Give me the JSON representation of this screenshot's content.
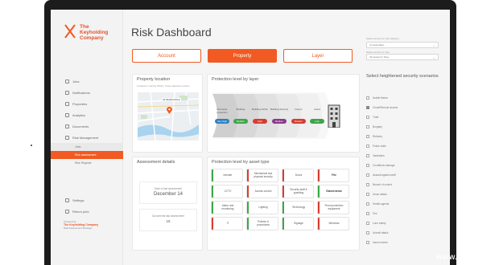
{
  "logo": {
    "line1": "The",
    "line2": "Keyholding",
    "line3": "Company"
  },
  "nav": {
    "items": [
      {
        "icon": "user-icon",
        "label": "Jobs"
      },
      {
        "icon": "clipboard-icon",
        "label": "Notifications"
      },
      {
        "icon": "building-icon",
        "label": "Properties"
      },
      {
        "icon": "chart-icon",
        "label": "Analytics"
      },
      {
        "icon": "document-icon",
        "label": "Documents"
      },
      {
        "icon": "shield-icon",
        "label": "Risk Management"
      }
    ],
    "subitems": [
      {
        "label": "Jobs",
        "state": "alt"
      },
      {
        "label": "Risk assessment",
        "state": "active"
      },
      {
        "label": "Risk Register",
        "state": ""
      }
    ],
    "bottom": [
      {
        "icon": "gear-icon",
        "label": "Settings"
      },
      {
        "icon": "logout-icon",
        "label": "Return jobs"
      }
    ],
    "powered_label": "Powered by",
    "powered_brand": "The Keyholding Company",
    "powered_sub": "Risk Assessment Manager"
  },
  "page": {
    "title": "Risk Dashboard"
  },
  "tabs": [
    {
      "label": "Account",
      "active": false
    },
    {
      "label": "Property",
      "active": true
    },
    {
      "label": "Layer",
      "active": false
    }
  ],
  "property_location": {
    "title": "Property location",
    "subtitle": "Located in Canary Wharf, Tower Hamlets London",
    "pin_label": "44 Stratford Drive"
  },
  "protection_by_layer": {
    "title": "Protection level by layer",
    "layers": [
      {
        "name": "Perimeter protection",
        "badge": "Very High",
        "color": "#2f7fc1"
      },
      {
        "name": "Building",
        "badge": "Medium",
        "color": "#3ea54a"
      },
      {
        "name": "Building Fabric",
        "badge": "High",
        "color": "#d83c2f"
      },
      {
        "name": "Building Security",
        "badge": "Medium",
        "color": "#8a3a8f"
      },
      {
        "name": "Interior",
        "badge": "Medium",
        "color": "#d83c2f"
      },
      {
        "name": "Asset",
        "badge": "Low",
        "color": "#3ea54a"
      }
    ]
  },
  "protection_by_asset": {
    "title": "Protection level by asset type",
    "cells": [
      {
        "label": "Intruder",
        "status": "g",
        "bold": false
      },
      {
        "label": "Mechanical and physical security",
        "status": "r",
        "bold": false
      },
      {
        "label": "Doors",
        "status": "r",
        "bold": false
      },
      {
        "label": "Fire",
        "status": "r",
        "bold": true
      },
      {
        "label": "CCTV",
        "status": "g",
        "bold": false
      },
      {
        "label": "Access control",
        "status": "r",
        "bold": false
      },
      {
        "label": "Security staff & guarding",
        "status": "r",
        "bold": false
      },
      {
        "label": "Glazed areas",
        "status": "g",
        "bold": true
      },
      {
        "label": "Alarm and monitoring",
        "status": "g",
        "bold": false
      },
      {
        "label": "Lighting",
        "status": "g",
        "bold": false
      },
      {
        "label": "Technology",
        "status": "g",
        "bold": false
      },
      {
        "label": "Flood protection equipment",
        "status": "r",
        "bold": false
      },
      {
        "label": "IT",
        "status": "r",
        "bold": false
      },
      {
        "label": "Policies & procedures",
        "status": "g",
        "bold": false
      },
      {
        "label": "Signage",
        "status": "g",
        "bold": false
      },
      {
        "label": "Windows",
        "status": "r",
        "bold": false
      }
    ]
  },
  "assessment": {
    "title": "Assessment details",
    "date_label": "Date of last assessment",
    "date_value": "December 14",
    "docs_label": "Documents last assessment",
    "docs_value": "15"
  },
  "filters": {
    "label1": "Select account or site category",
    "select1": "Consumables",
    "label2": "Select account or site",
    "select2": "All assets by Sites",
    "heading": "Select heightened security scenarios",
    "options": [
      {
        "label": "Arable theme",
        "checked": false
      },
      {
        "label": "Cloud/Remote access",
        "checked": true
      },
      {
        "label": "Theft",
        "checked": false
      },
      {
        "label": "Burglary",
        "checked": false
      },
      {
        "label": "Robbery",
        "checked": false
      },
      {
        "label": "Police visits",
        "checked": false
      },
      {
        "label": "Vandalism",
        "checked": false
      },
      {
        "label": "Conditions damage",
        "checked": false
      },
      {
        "label": "Assault against staff",
        "checked": false
      },
      {
        "label": "Breach of control",
        "checked": false
      },
      {
        "label": "Arson attack",
        "checked": false
      },
      {
        "label": "Hostile agents",
        "checked": false
      },
      {
        "label": "Fire",
        "checked": false
      },
      {
        "label": "Lone safety",
        "checked": false
      },
      {
        "label": "Aircraft attack",
        "checked": false
      },
      {
        "label": "Insect events",
        "checked": false
      }
    ]
  },
  "watermark": "www.fmj.co.uk"
}
